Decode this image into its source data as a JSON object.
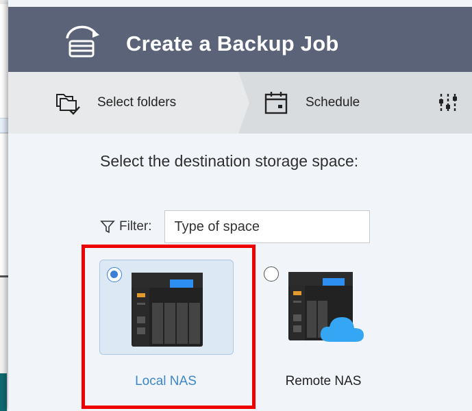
{
  "dialog": {
    "title": "Create a Backup Job"
  },
  "steps": [
    {
      "label": "Select folders",
      "icon": "select-folders-icon",
      "active": true
    },
    {
      "label": "Schedule",
      "icon": "calendar-icon",
      "active": false
    },
    {
      "label": "",
      "icon": "sliders-icon",
      "active": false
    }
  ],
  "destination": {
    "prompt": "Select the destination storage space:",
    "filter_label": "Filter:",
    "filter_value": "Type of space"
  },
  "options": [
    {
      "label": "Local NAS",
      "selected": true,
      "icon": "local-nas-icon"
    },
    {
      "label": "Remote NAS",
      "selected": false,
      "icon": "remote-nas-icon"
    }
  ],
  "colors": {
    "header": "#5b6379",
    "accent": "#3d7fd6",
    "highlight": "#ee0000"
  }
}
